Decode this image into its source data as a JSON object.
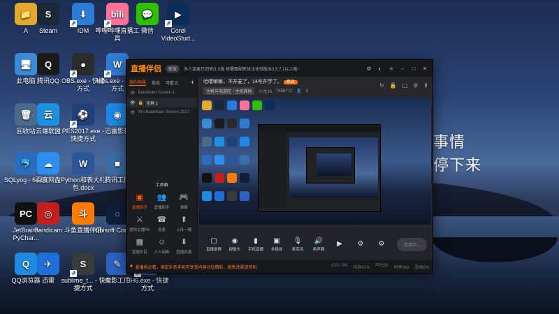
{
  "wallpaper": {
    "text_line1": "事情",
    "text_line2": "停下来"
  },
  "desktop_icons": [
    {
      "label": "A",
      "color": "#e3a92b",
      "glyph": "📁"
    },
    {
      "label": "Steam",
      "color": "#1b2838",
      "glyph": "S"
    },
    {
      "label": "IDM",
      "color": "#2c7bd6",
      "glyph": "⬇"
    },
    {
      "label": "哔哩哔哩直播工具",
      "color": "#fb7299",
      "glyph": "bili"
    },
    {
      "label": "微信",
      "color": "#2dc100",
      "glyph": "💬"
    },
    {
      "label": "Corel VideoStud...",
      "color": "#0a2e5a",
      "glyph": "▶"
    },
    {
      "label": "此电脑",
      "color": "#3a8ad6",
      "glyph": "🖥"
    },
    {
      "label": "腾讯QQ",
      "color": "#1a1a1a",
      "glyph": "Q"
    },
    {
      "label": "OBS.exe - 快捷方式",
      "color": "#2b2b2b",
      "glyph": "●"
    },
    {
      "label": "wps.exe - 快捷方式",
      "color": "#2f7cd3",
      "glyph": "W"
    },
    {
      "label": "回收站",
      "color": "#4a6a8c",
      "glyph": "🗑"
    },
    {
      "label": "云端联盟",
      "color": "#1e90e0",
      "glyph": "云"
    },
    {
      "label": "PES2017.exe - 快捷方式",
      "color": "#1d3f7a",
      "glyph": "⚽"
    },
    {
      "label": "迅雷影音",
      "color": "#1e88e5",
      "glyph": "◉"
    },
    {
      "label": "SQLyog - 64 bit",
      "color": "#2a6dc0",
      "glyph": "🐬"
    },
    {
      "label": "百度网盘",
      "color": "#2f8ff0",
      "glyph": "☁"
    },
    {
      "label": "Python和表大礼包.docx",
      "color": "#2b579a",
      "glyph": "W"
    },
    {
      "label": "腾讯工厂",
      "color": "#3a6ea5",
      "glyph": "■"
    },
    {
      "label": "JetBrains PyChar...",
      "color": "#111111",
      "glyph": "PC"
    },
    {
      "label": "Bandicam",
      "color": "#c21f1f",
      "glyph": "◎"
    },
    {
      "label": "斗鱼直播伴侣",
      "color": "#ff7a00",
      "glyph": "斗"
    },
    {
      "label": "Ubisoft Connect",
      "color": "#0f1e3a",
      "glyph": "◌"
    },
    {
      "label": "QQ浏览器",
      "color": "#1c8be0",
      "glyph": "Q"
    },
    {
      "label": "迅雷",
      "color": "#1e6fd9",
      "glyph": "✈"
    },
    {
      "label": "sublime_t... - 快捷方式",
      "color": "#3b3b3b",
      "glyph": "S"
    },
    {
      "label": "魔影工厂",
      "color": "#2d62c2",
      "glyph": "✎"
    },
    {
      "label": "BH6.exe - 快捷方式",
      "color": "#3f6fae",
      "glyph": "■"
    }
  ],
  "app": {
    "logo": "直播伴侣",
    "version_badge": "新版",
    "announcement": "多人连麦已到来(1.0版 按需跟配新玩法体验版本3.5.7.1以上哦~",
    "title_icons": [
      "gear-icon",
      "shirt-icon",
      "menu-icon",
      "min-icon",
      "max-icon",
      "close-icon"
    ],
    "sidebar": {
      "tabs": [
        "我的场景",
        "我出",
        "可看点"
      ],
      "add": "+",
      "scenes": [
        {
          "label": "Bandicam Screen 1",
          "selected": false
        },
        {
          "label": "全屏 1",
          "selected": true
        },
        {
          "label": "Pro Bandicam Screen 2017",
          "selected": false
        }
      ],
      "tools_title": "工具箱",
      "tools": [
        {
          "label": "直播助手",
          "icon": "▣",
          "hot": true
        },
        {
          "label": "直播助手",
          "icon": "👥",
          "hot": false
        },
        {
          "label": "弹幕",
          "icon": "🎮",
          "hot": false
        },
        {
          "label": "虚拟主播PK",
          "icon": "⚔",
          "hot": false
        },
        {
          "label": "连麦",
          "icon": "☎",
          "hot": false
        },
        {
          "label": "上传一键",
          "icon": "⬆",
          "hot": false
        },
        {
          "label": "直播节目",
          "icon": "▦",
          "hot": false
        },
        {
          "label": "人人动画",
          "icon": "☺",
          "hot": false
        },
        {
          "label": "直播资源",
          "icon": "⬇",
          "hot": false
        },
        {
          "label": "",
          "icon": "⊞",
          "hot": false
        },
        {
          "label": "",
          "icon": "☆",
          "hot": false
        },
        {
          "label": "",
          "icon": "⇪",
          "hot": false
        }
      ]
    },
    "stream": {
      "title": "哈喽嘛嘛，不开麦了，14号开学了。",
      "edit_badge": "修改",
      "category": "主机与电游区 - 主机其他",
      "follow_label": "小主16",
      "room_id": "7658772",
      "viewer_count": "0",
      "right_icons": [
        "share-icon",
        "lock-icon",
        "copy-icon",
        "settings-icon",
        "record-icon"
      ]
    },
    "controls": [
      {
        "label": "直播录屏",
        "icon": "▢"
      },
      {
        "label": "摄像头",
        "icon": "◉"
      },
      {
        "label": "手机直播",
        "icon": "▮"
      },
      {
        "label": "多媒体",
        "icon": "▣"
      },
      {
        "label": "麦克风",
        "icon": "🎙"
      },
      {
        "label": "扬声器",
        "icon": "🔊"
      },
      {
        "label": "",
        "icon": "▶"
      },
      {
        "label": "",
        "icon": "⚙"
      },
      {
        "label": "",
        "icon": "⚙"
      }
    ],
    "go_live_label": "连接中...",
    "status_notice": "直播前必看，绑定实名手机可享受内容对比精彩、避免违规现有机",
    "stats": [
      "CPU 2%",
      "内存41%",
      "FPS30",
      "码率0kb",
      "丢帧0%"
    ]
  }
}
